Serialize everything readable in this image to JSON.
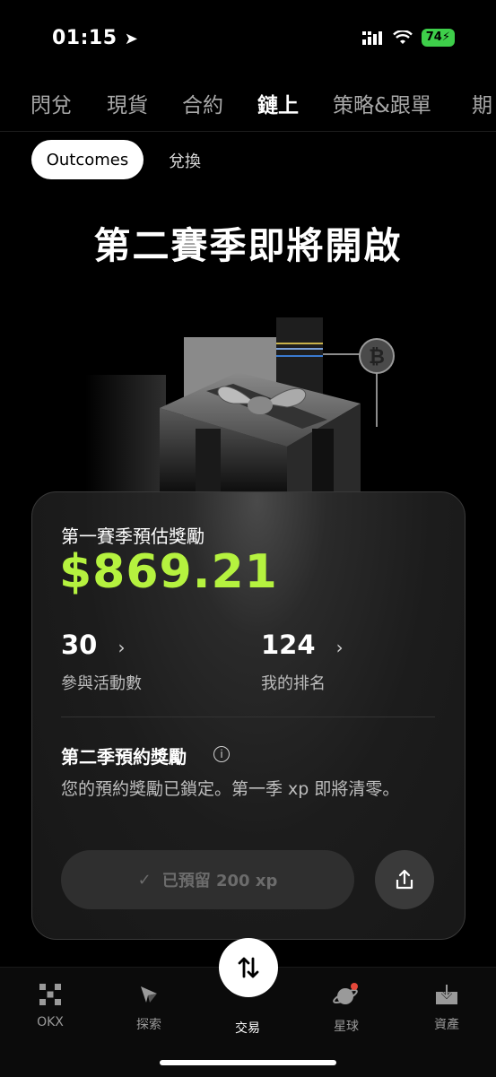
{
  "status_bar": {
    "time": "01:15",
    "battery": "74"
  },
  "top_tabs": [
    {
      "label": "閃兌",
      "active": false
    },
    {
      "label": "現貨",
      "active": false
    },
    {
      "label": "合約",
      "active": false
    },
    {
      "label": "鏈上",
      "active": true
    },
    {
      "label": "策略&跟單",
      "active": false
    },
    {
      "label": "期",
      "active": false
    }
  ],
  "sub_tabs": {
    "outcomes": "Outcomes",
    "swap": "兌換"
  },
  "headline": "第二賽季即將開啟",
  "card": {
    "season1_label": "第一賽季預估獎勵",
    "season1_value": "$869.21",
    "stats": [
      {
        "value": "30",
        "label": "參與活動數"
      },
      {
        "value": "124",
        "label": "我的排名"
      }
    ],
    "season2_label": "第二季預約獎勵",
    "season2_desc": "您的預約獎勵已鎖定。第一季 xp 即將清零。",
    "reserved_button": "已預留 200 xp"
  },
  "bottom_nav": [
    {
      "label": "OKX",
      "icon": "okx-logo-icon"
    },
    {
      "label": "探索",
      "icon": "compass-icon"
    },
    {
      "label": "交易",
      "icon": "trade-swap-icon"
    },
    {
      "label": "星球",
      "icon": "planet-icon"
    },
    {
      "label": "資產",
      "icon": "assets-download-icon"
    }
  ],
  "colors": {
    "accent_green": "#b5f23f",
    "battery_green": "#3ecf4a",
    "notification_red": "#e5483a"
  }
}
